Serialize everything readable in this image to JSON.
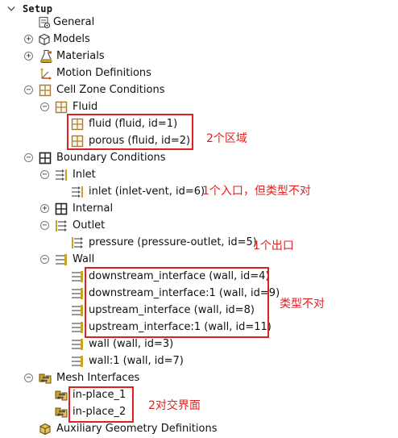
{
  "colors": {
    "annotation": "#e01f1f",
    "icon_gray": "#6b6b6b",
    "icon_gold": "#c9a227",
    "table_brown": "#a57b3c"
  },
  "tree": {
    "root": {
      "label": "Setup",
      "icon": "chevron-down-icon"
    },
    "general": {
      "label": "General",
      "icon": "general-settings-icon"
    },
    "models": {
      "label": "Models",
      "icon": "models-cube-icon"
    },
    "materials": {
      "label": "Materials",
      "icon": "materials-flask-icon"
    },
    "motion": {
      "label": "Motion Definitions",
      "icon": "motion-axes-icon"
    },
    "cell_zones": {
      "label": "Cell Zone Conditions",
      "icon": "cell-zone-icon",
      "fluid": {
        "label": "Fluid",
        "icon": "cell-zone-icon",
        "items": [
          {
            "label": "fluid (fluid, id=1)"
          },
          {
            "label": "porous (fluid, id=2)"
          }
        ]
      }
    },
    "boundary": {
      "label": "Boundary Conditions",
      "icon": "boundary-conditions-icon",
      "inlet": {
        "label": "Inlet",
        "icon": "inlet-icon",
        "items": [
          {
            "label": "inlet (inlet-vent, id=6)"
          }
        ]
      },
      "internal": {
        "label": "Internal",
        "icon": "internal-icon"
      },
      "outlet": {
        "label": "Outlet",
        "icon": "outlet-icon",
        "items": [
          {
            "label": "pressure (pressure-outlet, id=5)"
          }
        ]
      },
      "wall": {
        "label": "Wall",
        "icon": "wall-icon",
        "items": [
          {
            "label": "downstream_interface (wall, id=4)"
          },
          {
            "label": "downstream_interface:1 (wall, id=9)"
          },
          {
            "label": "upstream_interface (wall, id=8)"
          },
          {
            "label": "upstream_interface:1 (wall, id=11)"
          },
          {
            "label": "wall (wall, id=3)"
          },
          {
            "label": "wall:1 (wall, id=7)"
          }
        ]
      }
    },
    "mesh_interfaces": {
      "label": "Mesh Interfaces",
      "icon": "mesh-interface-icon",
      "items": [
        {
          "label": "in-place_1"
        },
        {
          "label": "in-place_2"
        }
      ]
    },
    "aux_geometry": {
      "label": "Auxiliary Geometry Definitions",
      "icon": "aux-geometry-icon"
    }
  },
  "annotations": {
    "zones": "2个区域",
    "inlet": "1个入口，但类型不对",
    "outlet": "1个出口",
    "wall": "类型不对",
    "interfaces": "2对交界面"
  }
}
